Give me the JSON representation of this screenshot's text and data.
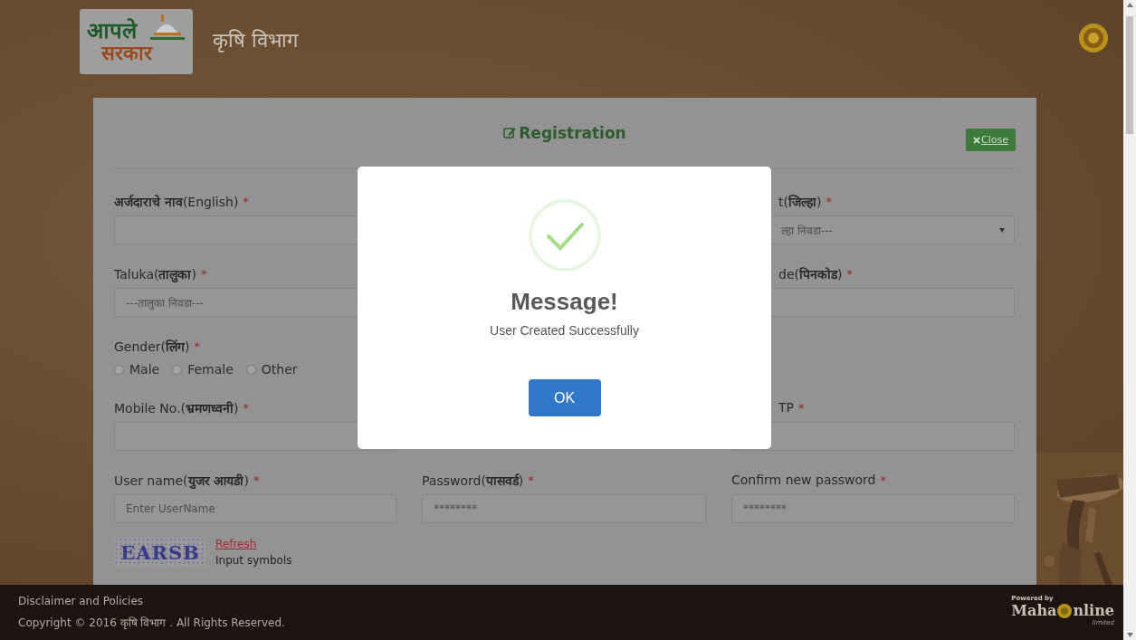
{
  "header": {
    "logo": {
      "line1": "आपले",
      "line2": "सरकार"
    },
    "title": "कृषि विभाग"
  },
  "form": {
    "title": "Registration",
    "close_button": "Close",
    "rows": [
      {
        "kind": "fields",
        "cells": [
          {
            "kind": "input",
            "label": "**अर्जदाराचे नाव**(English)",
            "required": "*"
          },
          {
            "kind": "select",
            "label": "t(**जिल्हा**)",
            "required": "*",
            "placeholder": "ल्हा निवडा---"
          }
        ]
      },
      {
        "kind": "fields",
        "cells": [
          {
            "kind": "select",
            "label": "Taluka(**तालुका**)",
            "required": "*",
            "placeholder": "---तालुका निवडा---"
          },
          {
            "kind": "input",
            "label": "de(**पिनकोड**)",
            "required": "*"
          }
        ]
      },
      {
        "kind": "radio",
        "label": "Gender(**लिंग**)",
        "required": "*",
        "options": [
          {
            "label": "Male",
            "selected": false
          },
          {
            "label": "Female",
            "selected": false
          },
          {
            "label": "Other",
            "selected": false
          }
        ]
      },
      {
        "kind": "fields",
        "cells": [
          {
            "kind": "input",
            "label": "Mobile No.(**भ्रमणध्वनी**)",
            "required": "*"
          },
          {
            "kind": "input",
            "label": "TP",
            "required": "*"
          }
        ]
      },
      {
        "kind": "fields",
        "cells": [
          {
            "kind": "input",
            "label": "User name(**युजर आयडी**)",
            "required": "*",
            "placeholder": "Enter UserName"
          },
          {
            "kind": "input",
            "label": "Password(**पासवर्ड**)",
            "required": "*",
            "placeholder": "********"
          },
          {
            "kind": "input",
            "label": "Confirm new password",
            "required": "*",
            "placeholder": "********"
          }
        ]
      }
    ],
    "captcha": {
      "text": "EARSB",
      "refresh": "Refresh",
      "hint": "Input symbols"
    }
  },
  "modal": {
    "title": "Message!",
    "message": "User Created Successfully",
    "button": "OK"
  },
  "footer": {
    "link": "Disclaimer and Policies",
    "copyright": "Copyright © 2016 कृषि विभाग . All Rights Reserved.",
    "powered": {
      "by": "Powered by",
      "left": "Maha",
      "right": "nline",
      "suffix": "limited"
    }
  }
}
